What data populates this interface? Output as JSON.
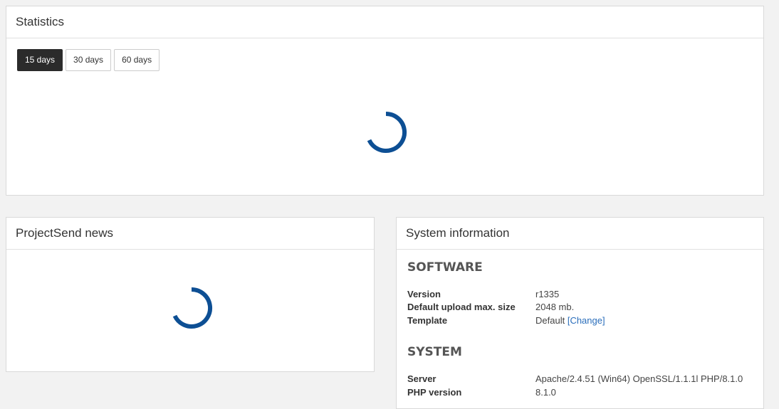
{
  "statistics": {
    "title": "Statistics",
    "buttons": [
      {
        "label": "15 days",
        "active": true
      },
      {
        "label": "30 days",
        "active": false
      },
      {
        "label": "60 days",
        "active": false
      }
    ]
  },
  "news": {
    "title": "ProjectSend news"
  },
  "system_info": {
    "title": "System information",
    "software": {
      "heading": "SOFTWARE",
      "rows": [
        {
          "label": "Version",
          "value": "r1335"
        },
        {
          "label": "Default upload max. size",
          "value": "2048 mb."
        },
        {
          "label": "Template",
          "value": "Default",
          "link": "[Change]"
        }
      ]
    },
    "system": {
      "heading": "SYSTEM",
      "rows": [
        {
          "label": "Server",
          "value": "Apache/2.4.51 (Win64) OpenSSL/1.1.1l PHP/8.1.0"
        },
        {
          "label": "PHP version",
          "value": "8.1.0"
        }
      ]
    }
  },
  "colors": {
    "spinner": "#0d4f94",
    "active_button": "#2b2b2b",
    "link": "#2a6ebb"
  }
}
